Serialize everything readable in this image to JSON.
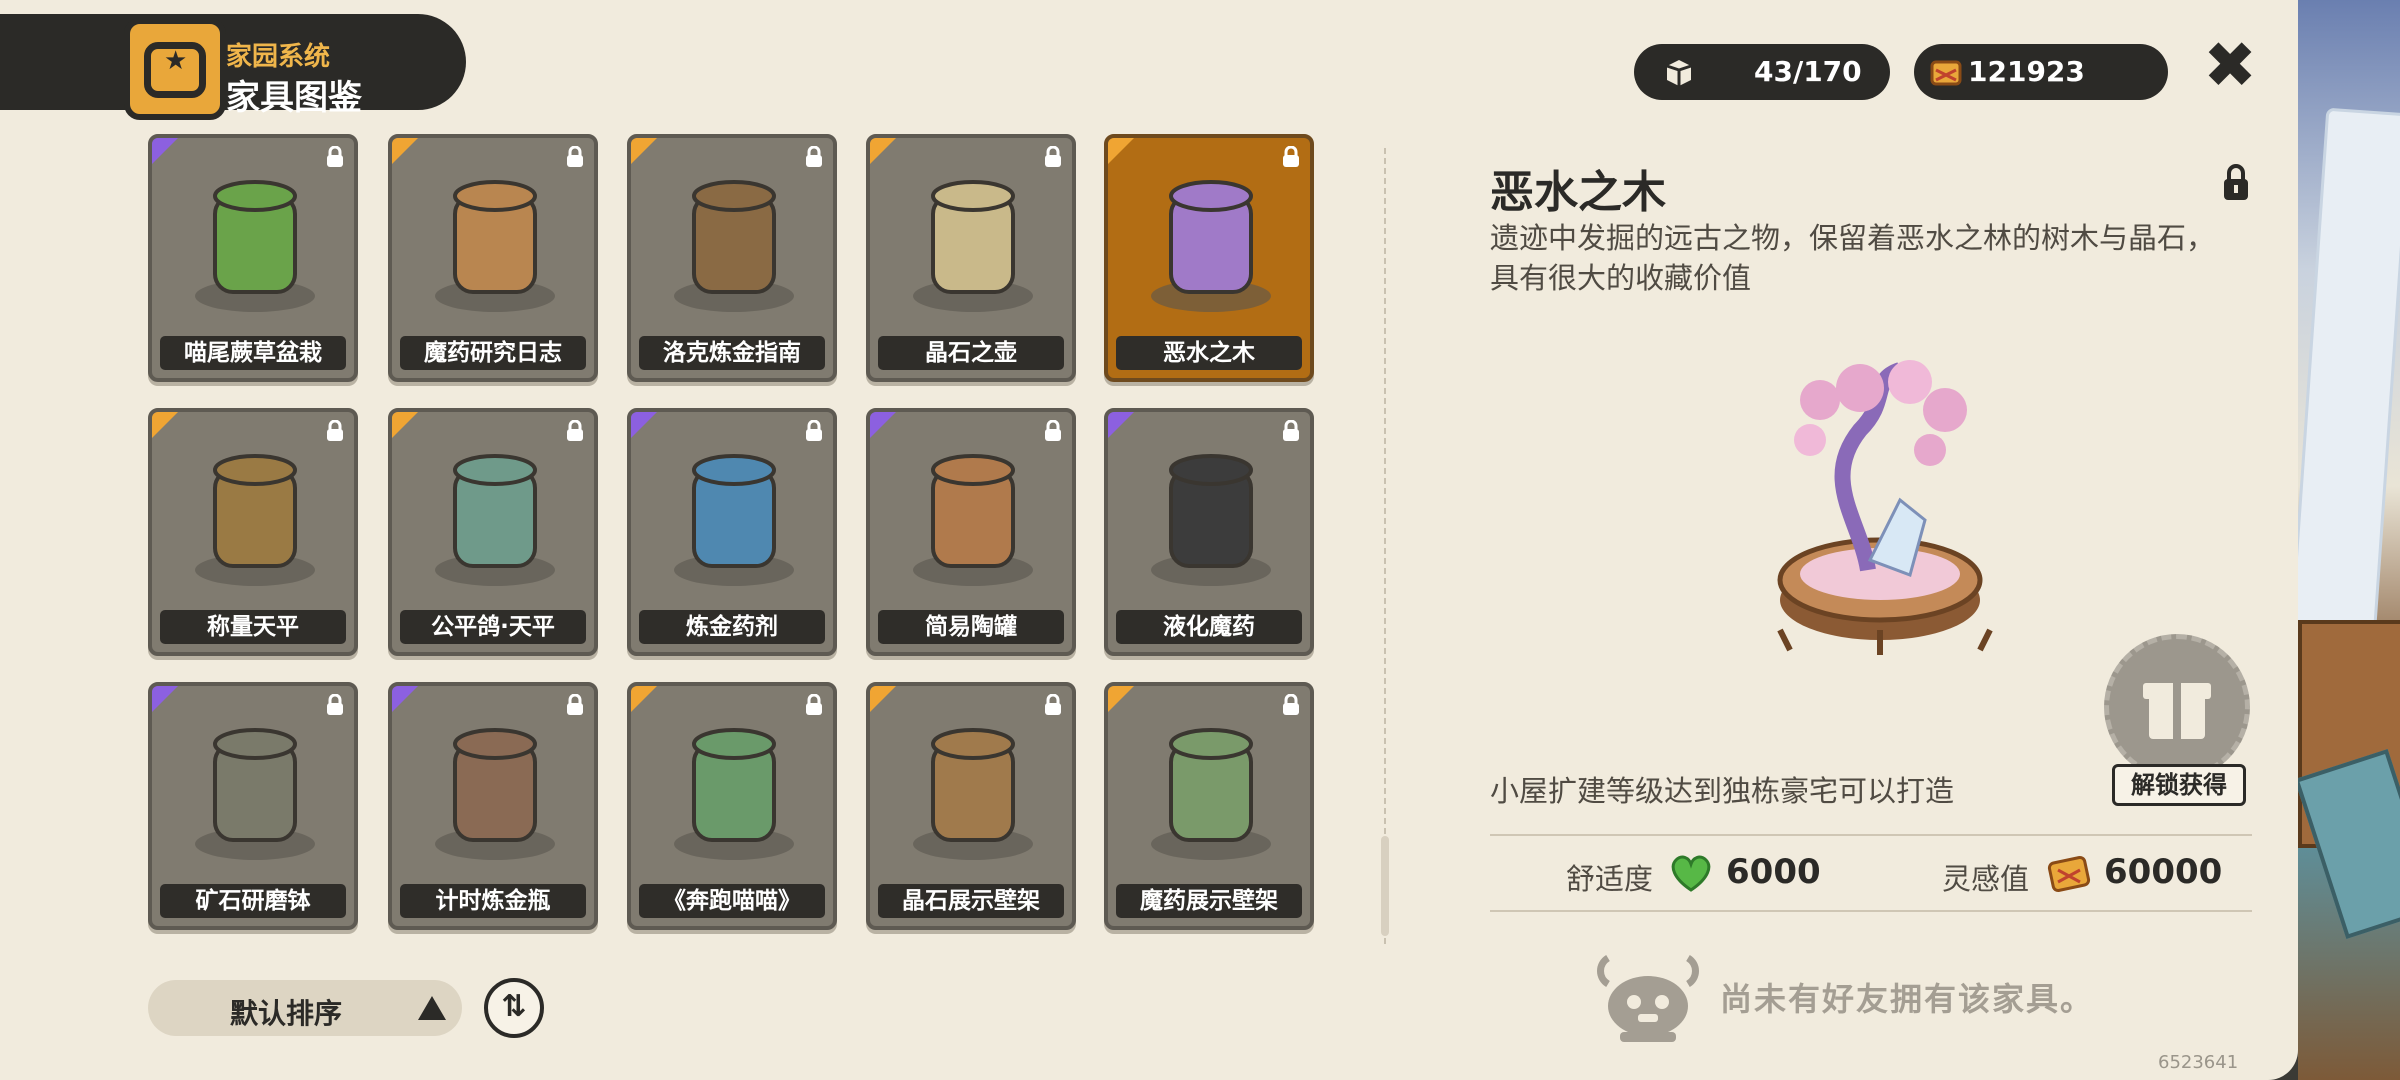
{
  "header": {
    "subtitle": "家园系统",
    "title": "家具图鉴"
  },
  "counters": {
    "collected": "43/170",
    "currency": "121923"
  },
  "grid": {
    "items": [
      {
        "label": "喵尾蕨草盆栽",
        "rarity": "purple",
        "locked": true,
        "selected": false
      },
      {
        "label": "魔药研究日志",
        "rarity": "orange",
        "locked": true,
        "selected": false
      },
      {
        "label": "洛克炼金指南",
        "rarity": "orange",
        "locked": true,
        "selected": false
      },
      {
        "label": "晶石之壶",
        "rarity": "orange",
        "locked": true,
        "selected": false
      },
      {
        "label": "恶水之木",
        "rarity": "orange",
        "locked": true,
        "selected": true
      },
      {
        "label": "称量天平",
        "rarity": "orange",
        "locked": true,
        "selected": false
      },
      {
        "label": "公平鸽·天平",
        "rarity": "orange",
        "locked": true,
        "selected": false
      },
      {
        "label": "炼金药剂",
        "rarity": "purple",
        "locked": true,
        "selected": false
      },
      {
        "label": "简易陶罐",
        "rarity": "purple",
        "locked": true,
        "selected": false
      },
      {
        "label": "液化魔药",
        "rarity": "purple",
        "locked": true,
        "selected": false
      },
      {
        "label": "矿石研磨钵",
        "rarity": "purple",
        "locked": true,
        "selected": false
      },
      {
        "label": "计时炼金瓶",
        "rarity": "purple",
        "locked": true,
        "selected": false
      },
      {
        "label": "《奔跑喵喵》",
        "rarity": "orange",
        "locked": true,
        "selected": false
      },
      {
        "label": "晶石展示壁架",
        "rarity": "orange",
        "locked": true,
        "selected": false
      },
      {
        "label": "魔药展示壁架",
        "rarity": "orange",
        "locked": true,
        "selected": false
      }
    ]
  },
  "sort": {
    "label": "默认排序",
    "order_icon": "⇅"
  },
  "detail": {
    "title": "恶水之木",
    "description": "遗迹中发掘的远古之物，保留着恶水之林的树木与晶石，具有很大的收藏价值",
    "requirement": "小屋扩建等级达到独栋豪宅可以打造",
    "unlock_button": "解锁获得",
    "comfort_label": "舒适度",
    "comfort_value": "6000",
    "inspiration_label": "灵感值",
    "inspiration_value": "60000",
    "no_friend": "尚未有好友拥有该家具。"
  },
  "uid": "6523641",
  "colors": {
    "orange_rarity": "#f0a533",
    "purple_rarity": "#8c60e0",
    "selected_card": "#b26d14",
    "dark": "#2b2a27",
    "panel": "#f1ebdd"
  }
}
